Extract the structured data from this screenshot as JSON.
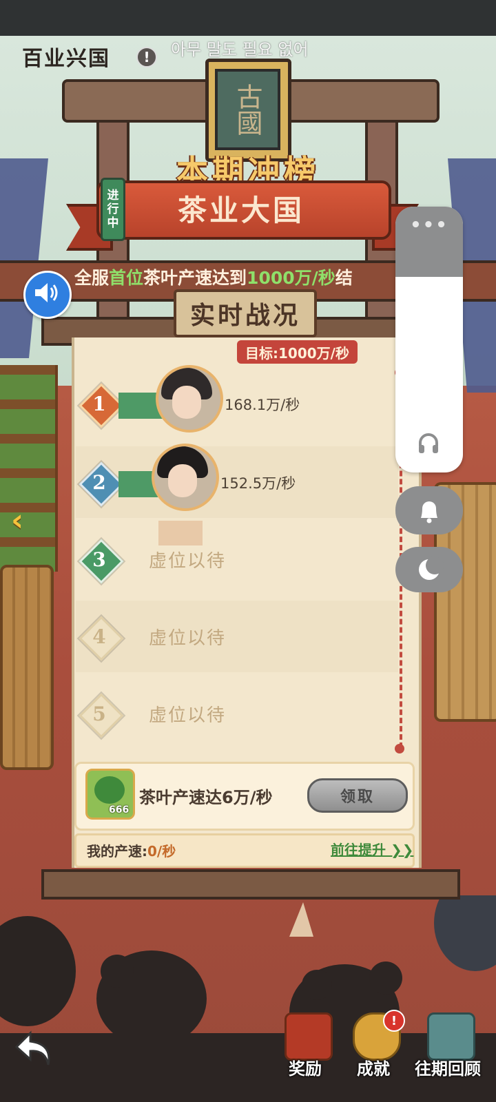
{
  "header": {
    "title": "百业兴国",
    "info_symbol": "!",
    "overlay_text": "아무 말도 필요 없어"
  },
  "event": {
    "title": "本期冲榜",
    "name": "茶业大国",
    "status": "进行中",
    "description_parts": [
      "全服",
      "首位",
      "茶叶产速达到",
      "1000万/秒",
      "结"
    ],
    "section_title": "实时战况",
    "target_label": "目标:1000万/秒",
    "seal_text": "古國"
  },
  "ranking": {
    "rows": [
      {
        "rank": "1",
        "speed": "168.1万/秒",
        "progress": 0.17
      },
      {
        "rank": "2",
        "speed": "152.5万/秒",
        "progress": 0.15
      },
      {
        "rank": "3",
        "placeholder": "虚位以待"
      },
      {
        "rank": "4",
        "placeholder": "虚位以待"
      },
      {
        "rank": "5",
        "placeholder": "虚位以待"
      }
    ]
  },
  "reward": {
    "count": "666",
    "description": "茶叶产速达6万/秒",
    "claim_label": "领取"
  },
  "my_speed": {
    "label": "我的产速:",
    "value": "0/秒",
    "go_label": "前往提升"
  },
  "side_panel": {
    "dots": "•••"
  },
  "nav": {
    "left_arrow": "‹",
    "items": [
      {
        "label": "奖励",
        "icon": "treasure-chest-icon"
      },
      {
        "label": "成就",
        "icon": "qilin-icon",
        "badge": "!"
      },
      {
        "label": "往期回顾",
        "icon": "book-icon"
      }
    ]
  },
  "colors": {
    "accent_green": "#4e9a66",
    "highlight_green": "#8fe06a",
    "target_red": "#c4453b",
    "speaker_blue": "#2f7fe0"
  }
}
